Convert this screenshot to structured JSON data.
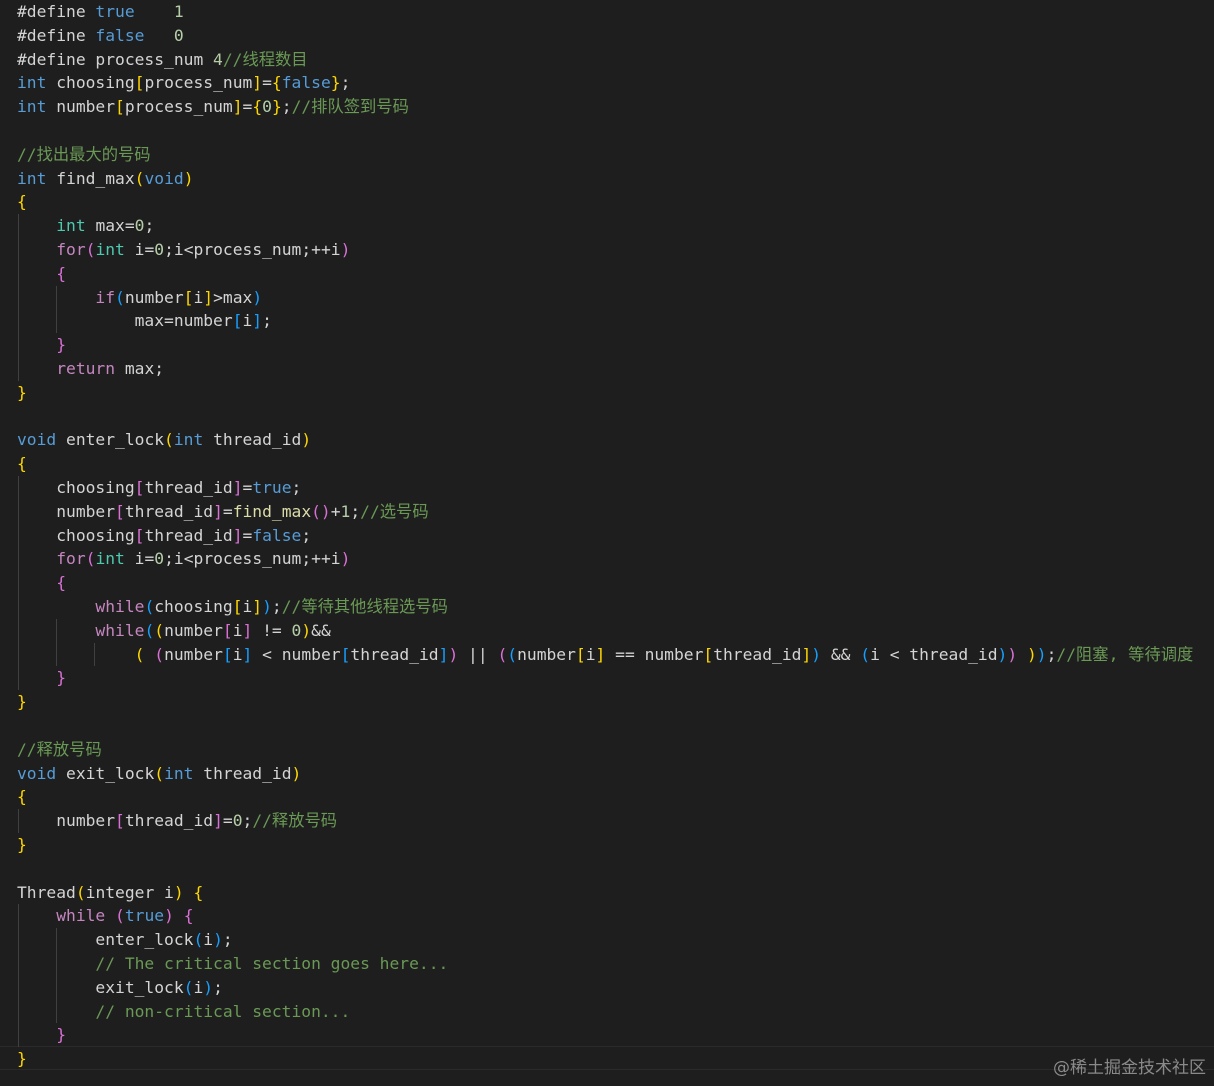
{
  "editor": {
    "language": "c",
    "colors": {
      "background": "#1e1e1e",
      "keyword": "#569cd6",
      "control": "#c586c0",
      "type": "#4ec9b0",
      "function": "#dcdcaa",
      "identifier": "#d4d4d4",
      "parameter": "#9cdcfe",
      "number": "#b5cea8",
      "comment": "#6a9955",
      "bracket_gold": "#ffd700",
      "bracket_magenta": "#da70d6",
      "bracket_blue": "#179fff"
    },
    "lines": [
      [
        [
          "#define ",
          "#d4d4d4"
        ],
        [
          "true",
          "#569cd6"
        ],
        [
          "    ",
          "#d4d4d4"
        ],
        [
          "1",
          "#b5cea8"
        ]
      ],
      [
        [
          "#define ",
          "#d4d4d4"
        ],
        [
          "false",
          "#569cd6"
        ],
        [
          "   ",
          "#d4d4d4"
        ],
        [
          "0",
          "#b5cea8"
        ]
      ],
      [
        [
          "#define process_num ",
          "#d4d4d4"
        ],
        [
          "4",
          "#b5cea8"
        ],
        [
          "//线程数目",
          "#6a9955"
        ]
      ],
      [
        [
          "int",
          "#569cd6"
        ],
        [
          " choosing",
          "#d4d4d4"
        ],
        [
          "[",
          "#ffd700"
        ],
        [
          "process_num",
          "#d4d4d4"
        ],
        [
          "]",
          "#ffd700"
        ],
        [
          "=",
          "#d4d4d4"
        ],
        [
          "{",
          "#ffd700"
        ],
        [
          "false",
          "#569cd6"
        ],
        [
          "}",
          "#ffd700"
        ],
        [
          ";",
          "#d4d4d4"
        ]
      ],
      [
        [
          "int",
          "#569cd6"
        ],
        [
          " number",
          "#d4d4d4"
        ],
        [
          "[",
          "#ffd700"
        ],
        [
          "process_num",
          "#d4d4d4"
        ],
        [
          "]",
          "#ffd700"
        ],
        [
          "=",
          "#d4d4d4"
        ],
        [
          "{",
          "#ffd700"
        ],
        [
          "0",
          "#b5cea8"
        ],
        [
          "}",
          "#ffd700"
        ],
        [
          ";",
          "#d4d4d4"
        ],
        [
          "//排队签到号码",
          "#6a9955"
        ]
      ],
      [],
      [
        [
          "//找出最大的号码",
          "#6a9955"
        ]
      ],
      [
        [
          "int",
          "#569cd6"
        ],
        [
          " find_max",
          "#d4d4d4"
        ],
        [
          "(",
          "#ffd700"
        ],
        [
          "void",
          "#569cd6"
        ],
        [
          ")",
          "#ffd700"
        ]
      ],
      [
        [
          "{",
          "#ffd700"
        ]
      ],
      [
        [
          "    ",
          "#d4d4d4"
        ],
        [
          "int",
          "#4ec9b0"
        ],
        [
          " max",
          "#d4d4d4"
        ],
        [
          "=",
          "#d4d4d4"
        ],
        [
          "0",
          "#b5cea8"
        ],
        [
          ";",
          "#d4d4d4"
        ]
      ],
      [
        [
          "    ",
          "#d4d4d4"
        ],
        [
          "for",
          "#c586c0"
        ],
        [
          "(",
          "#da70d6"
        ],
        [
          "int",
          "#4ec9b0"
        ],
        [
          " i=",
          "#d4d4d4"
        ],
        [
          "0",
          "#b5cea8"
        ],
        [
          ";i<process_num;++i",
          "#d4d4d4"
        ],
        [
          ")",
          "#da70d6"
        ]
      ],
      [
        [
          "    ",
          "#d4d4d4"
        ],
        [
          "{",
          "#da70d6"
        ]
      ],
      [
        [
          "        ",
          "#d4d4d4"
        ],
        [
          "if",
          "#c586c0"
        ],
        [
          "(",
          "#179fff"
        ],
        [
          "number",
          "#d4d4d4"
        ],
        [
          "[",
          "#ffd700"
        ],
        [
          "i",
          "#d4d4d4"
        ],
        [
          "]",
          "#ffd700"
        ],
        [
          ">max",
          "#d4d4d4"
        ],
        [
          ")",
          "#179fff"
        ]
      ],
      [
        [
          "            max=number",
          "#d4d4d4"
        ],
        [
          "[",
          "#179fff"
        ],
        [
          "i",
          "#d4d4d4"
        ],
        [
          "]",
          "#179fff"
        ],
        [
          ";",
          "#d4d4d4"
        ]
      ],
      [
        [
          "    ",
          "#d4d4d4"
        ],
        [
          "}",
          "#da70d6"
        ]
      ],
      [
        [
          "    ",
          "#d4d4d4"
        ],
        [
          "return",
          "#c586c0"
        ],
        [
          " max;",
          "#d4d4d4"
        ]
      ],
      [
        [
          "}",
          "#ffd700"
        ]
      ],
      [],
      [
        [
          "void",
          "#569cd6"
        ],
        [
          " enter_lock",
          "#d4d4d4"
        ],
        [
          "(",
          "#ffd700"
        ],
        [
          "int",
          "#569cd6"
        ],
        [
          " thread_id",
          "#d4d4d4"
        ],
        [
          ")",
          "#ffd700"
        ]
      ],
      [
        [
          "{",
          "#ffd700"
        ]
      ],
      [
        [
          "    choosing",
          "#d4d4d4"
        ],
        [
          "[",
          "#da70d6"
        ],
        [
          "thread_id",
          "#d4d4d4"
        ],
        [
          "]",
          "#da70d6"
        ],
        [
          "=",
          "#d4d4d4"
        ],
        [
          "true",
          "#569cd6"
        ],
        [
          ";",
          "#d4d4d4"
        ]
      ],
      [
        [
          "    number",
          "#d4d4d4"
        ],
        [
          "[",
          "#da70d6"
        ],
        [
          "thread_id",
          "#d4d4d4"
        ],
        [
          "]",
          "#da70d6"
        ],
        [
          "=",
          "#d4d4d4"
        ],
        [
          "find_max",
          "#dcdcaa"
        ],
        [
          "()",
          "#da70d6"
        ],
        [
          "+",
          "#d4d4d4"
        ],
        [
          "1",
          "#b5cea8"
        ],
        [
          ";",
          "#d4d4d4"
        ],
        [
          "//选号码",
          "#6a9955"
        ]
      ],
      [
        [
          "    choosing",
          "#d4d4d4"
        ],
        [
          "[",
          "#da70d6"
        ],
        [
          "thread_id",
          "#d4d4d4"
        ],
        [
          "]",
          "#da70d6"
        ],
        [
          "=",
          "#d4d4d4"
        ],
        [
          "false",
          "#569cd6"
        ],
        [
          ";",
          "#d4d4d4"
        ]
      ],
      [
        [
          "    ",
          "#d4d4d4"
        ],
        [
          "for",
          "#c586c0"
        ],
        [
          "(",
          "#da70d6"
        ],
        [
          "int",
          "#4ec9b0"
        ],
        [
          " i=",
          "#d4d4d4"
        ],
        [
          "0",
          "#b5cea8"
        ],
        [
          ";i<process_num;++i",
          "#d4d4d4"
        ],
        [
          ")",
          "#da70d6"
        ]
      ],
      [
        [
          "    ",
          "#d4d4d4"
        ],
        [
          "{",
          "#da70d6"
        ]
      ],
      [
        [
          "        ",
          "#d4d4d4"
        ],
        [
          "while",
          "#c586c0"
        ],
        [
          "(",
          "#179fff"
        ],
        [
          "choosing",
          "#d4d4d4"
        ],
        [
          "[",
          "#ffd700"
        ],
        [
          "i",
          "#d4d4d4"
        ],
        [
          "]",
          "#ffd700"
        ],
        [
          ")",
          "#179fff"
        ],
        [
          ";",
          "#d4d4d4"
        ],
        [
          "//等待其他线程选号码",
          "#6a9955"
        ]
      ],
      [
        [
          "        ",
          "#d4d4d4"
        ],
        [
          "while",
          "#c586c0"
        ],
        [
          "(",
          "#179fff"
        ],
        [
          "(",
          "#ffd700"
        ],
        [
          "number",
          "#d4d4d4"
        ],
        [
          "[",
          "#da70d6"
        ],
        [
          "i",
          "#d4d4d4"
        ],
        [
          "]",
          "#da70d6"
        ],
        [
          " != ",
          "#d4d4d4"
        ],
        [
          "0",
          "#b5cea8"
        ],
        [
          ")",
          "#ffd700"
        ],
        [
          "&&",
          "#d4d4d4"
        ]
      ],
      [
        [
          "            ",
          "#d4d4d4"
        ],
        [
          "(",
          "#ffd700"
        ],
        [
          " ",
          "#d4d4d4"
        ],
        [
          "(",
          "#da70d6"
        ],
        [
          "number",
          "#d4d4d4"
        ],
        [
          "[",
          "#179fff"
        ],
        [
          "i",
          "#d4d4d4"
        ],
        [
          "]",
          "#179fff"
        ],
        [
          " < number",
          "#d4d4d4"
        ],
        [
          "[",
          "#179fff"
        ],
        [
          "thread_id",
          "#d4d4d4"
        ],
        [
          "]",
          "#179fff"
        ],
        [
          ")",
          "#da70d6"
        ],
        [
          " || ",
          "#d4d4d4"
        ],
        [
          "(",
          "#da70d6"
        ],
        [
          "(",
          "#179fff"
        ],
        [
          "number",
          "#d4d4d4"
        ],
        [
          "[",
          "#ffd700"
        ],
        [
          "i",
          "#d4d4d4"
        ],
        [
          "]",
          "#ffd700"
        ],
        [
          " == number",
          "#d4d4d4"
        ],
        [
          "[",
          "#ffd700"
        ],
        [
          "thread_id",
          "#d4d4d4"
        ],
        [
          "]",
          "#ffd700"
        ],
        [
          ")",
          "#179fff"
        ],
        [
          " && ",
          "#d4d4d4"
        ],
        [
          "(",
          "#179fff"
        ],
        [
          "i < thread_id",
          "#d4d4d4"
        ],
        [
          ")",
          "#179fff"
        ],
        [
          ")",
          "#da70d6"
        ],
        [
          " ",
          "#d4d4d4"
        ],
        [
          ")",
          "#ffd700"
        ],
        [
          ")",
          "#179fff"
        ],
        [
          ";",
          "#d4d4d4"
        ],
        [
          "//阻塞, 等待调度",
          "#6a9955"
        ]
      ],
      [
        [
          "    ",
          "#d4d4d4"
        ],
        [
          "}",
          "#da70d6"
        ]
      ],
      [
        [
          "}",
          "#ffd700"
        ]
      ],
      [],
      [
        [
          "//释放号码",
          "#6a9955"
        ]
      ],
      [
        [
          "void",
          "#569cd6"
        ],
        [
          " exit_lock",
          "#d4d4d4"
        ],
        [
          "(",
          "#ffd700"
        ],
        [
          "int",
          "#569cd6"
        ],
        [
          " thread_id",
          "#d4d4d4"
        ],
        [
          ")",
          "#ffd700"
        ]
      ],
      [
        [
          "{",
          "#ffd700"
        ]
      ],
      [
        [
          "    number",
          "#d4d4d4"
        ],
        [
          "[",
          "#da70d6"
        ],
        [
          "thread_id",
          "#d4d4d4"
        ],
        [
          "]",
          "#da70d6"
        ],
        [
          "=",
          "#d4d4d4"
        ],
        [
          "0",
          "#b5cea8"
        ],
        [
          ";",
          "#d4d4d4"
        ],
        [
          "//释放号码",
          "#6a9955"
        ]
      ],
      [
        [
          "}",
          "#ffd700"
        ]
      ],
      [],
      [
        [
          "Thread",
          "#d4d4d4"
        ],
        [
          "(",
          "#ffd700"
        ],
        [
          "integer i",
          "#d4d4d4"
        ],
        [
          ")",
          "#ffd700"
        ],
        [
          " ",
          "#d4d4d4"
        ],
        [
          "{",
          "#ffd700"
        ]
      ],
      [
        [
          "    ",
          "#d4d4d4"
        ],
        [
          "while",
          "#c586c0"
        ],
        [
          " ",
          "#d4d4d4"
        ],
        [
          "(",
          "#da70d6"
        ],
        [
          "true",
          "#569cd6"
        ],
        [
          ")",
          "#da70d6"
        ],
        [
          " ",
          "#d4d4d4"
        ],
        [
          "{",
          "#da70d6"
        ]
      ],
      [
        [
          "        enter_lock",
          "#d4d4d4"
        ],
        [
          "(",
          "#179fff"
        ],
        [
          "i",
          "#d4d4d4"
        ],
        [
          ")",
          "#179fff"
        ],
        [
          ";",
          "#d4d4d4"
        ]
      ],
      [
        [
          "        ",
          "#d4d4d4"
        ],
        [
          "// The critical section goes here...",
          "#6a9955"
        ]
      ],
      [
        [
          "        exit_lock",
          "#d4d4d4"
        ],
        [
          "(",
          "#179fff"
        ],
        [
          "i",
          "#d4d4d4"
        ],
        [
          ")",
          "#179fff"
        ],
        [
          ";",
          "#d4d4d4"
        ]
      ],
      [
        [
          "        ",
          "#d4d4d4"
        ],
        [
          "// non-critical section...",
          "#6a9955"
        ]
      ],
      [
        [
          "    ",
          "#d4d4d4"
        ],
        [
          "}",
          "#da70d6"
        ]
      ],
      [
        [
          "}",
          "#ffd700"
        ]
      ]
    ]
  },
  "watermark": "@稀土掘金技术社区"
}
